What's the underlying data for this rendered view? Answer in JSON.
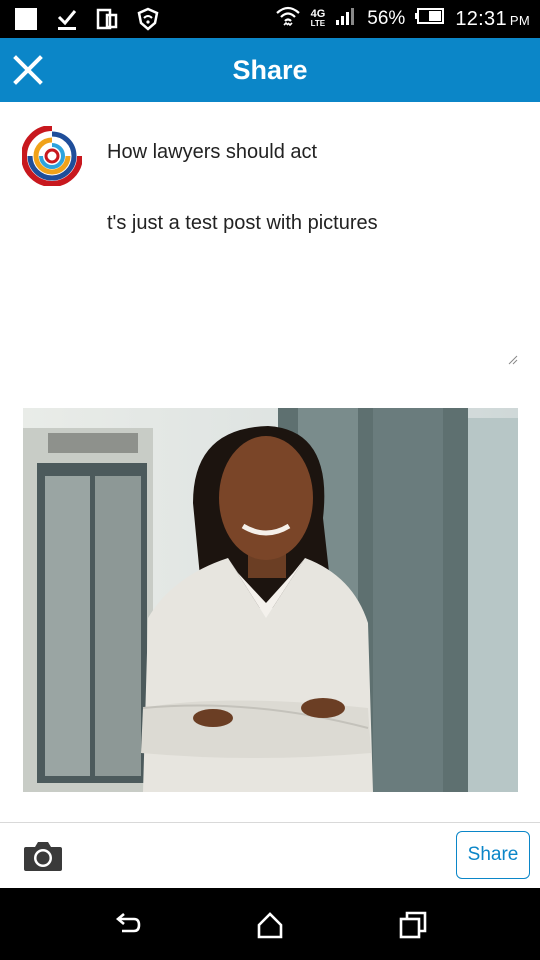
{
  "status_bar": {
    "battery_percent": "56%",
    "time": "12:31",
    "time_suffix": "PM",
    "network": "4G",
    "network_sub": "LTE"
  },
  "app_bar": {
    "title": "Share",
    "accent_color": "#0b86c8"
  },
  "post": {
    "title": "How lawyers should act",
    "text": "t's just a test post with pictures"
  },
  "toolbar": {
    "share_label": "Share"
  },
  "icons": {
    "close": "close-icon",
    "camera": "camera-icon",
    "back": "back-icon",
    "home": "home-icon",
    "recents": "recents-icon"
  }
}
